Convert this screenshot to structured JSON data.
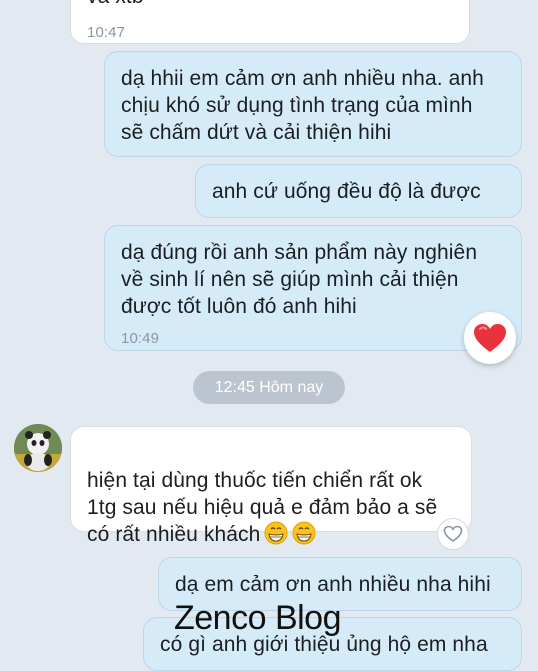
{
  "messages": [
    {
      "id": "m0",
      "sender": "theirs",
      "text": "và xtb",
      "time": "10:47"
    },
    {
      "id": "m1",
      "sender": "me",
      "text": "dạ hhii em cảm ơn anh nhiều nha. anh\nchịu khó sử dụng tình trạng của mình\nsẽ  chấm dứt và cải thiện hihi"
    },
    {
      "id": "m2",
      "sender": "me",
      "text": "anh cứ uống đều độ   là được"
    },
    {
      "id": "m3",
      "sender": "me",
      "text": "dạ đúng rồi anh sản phẩm này  nghiên\nvề sinh lí  nên sẽ giúp mình cải thiện\nđược tốt luôn đó anh hihi",
      "time": "10:49",
      "reaction": "heart-icon"
    },
    {
      "id": "m4",
      "sender": "theirs",
      "text": "hiện tại dùng thuốc tiến chiển rất ok\n1tg sau nếu hiệu quả e đảm bảo a sẽ\ncó rất nhiều khách",
      "emoji": [
        "grin-emoji",
        "grin-emoji"
      ]
    },
    {
      "id": "m5",
      "sender": "me",
      "text": "dạ em cảm ơn anh nhiều nha hihi"
    },
    {
      "id": "m6",
      "sender": "me",
      "text": "có gì anh giới thiệu ủng hộ em nha"
    }
  ],
  "day_separator": "12:45 Hôm nay",
  "watermark": "Zenco Blog",
  "colors": {
    "background": "#e2e9f1",
    "my_bubble": "#d6ebf8",
    "their_bubble": "#ffffff",
    "heart": "#e8323c"
  }
}
